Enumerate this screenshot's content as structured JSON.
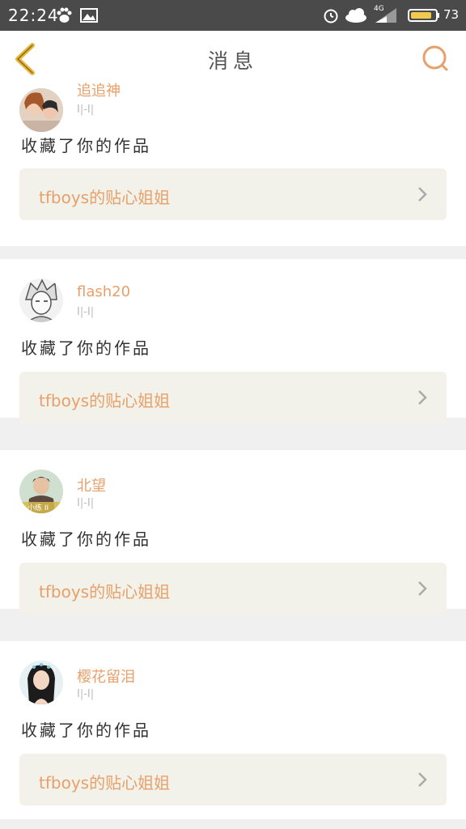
{
  "status_bar": {
    "time": "22:24",
    "battery": "73",
    "network": "4G",
    "icons": [
      "baidu-paw-icon",
      "image-icon",
      "alarm-icon",
      "cloud-icon",
      "signal-icon",
      "battery-icon"
    ]
  },
  "nav": {
    "title": "消息",
    "back_icon": "chevron-left-icon",
    "search_icon": "search-icon"
  },
  "colors": {
    "accent": "#e8a06a",
    "back_arrow": "#e8b63a",
    "card_bg": "#f2f2ea",
    "status_bg": "#4a4a4a"
  },
  "messages": [
    {
      "username": "追追神",
      "time": "I|-I|",
      "action": "收藏了你的作品",
      "work_title": "tfboys的贴心姐姐"
    },
    {
      "username": "flash20",
      "time": "I|-I|",
      "action": "收藏了你的作品",
      "work_title": "tfboys的贴心姐姐"
    },
    {
      "username": "北望",
      "time": "I|-I|",
      "action": "收藏了你的作品",
      "work_title": "tfboys的贴心姐姐",
      "avatar_caption": "小练 II"
    },
    {
      "username": "樱花留泪",
      "time": "I|-I|",
      "action": "收藏了你的作品",
      "work_title": "tfboys的贴心姐姐"
    }
  ]
}
